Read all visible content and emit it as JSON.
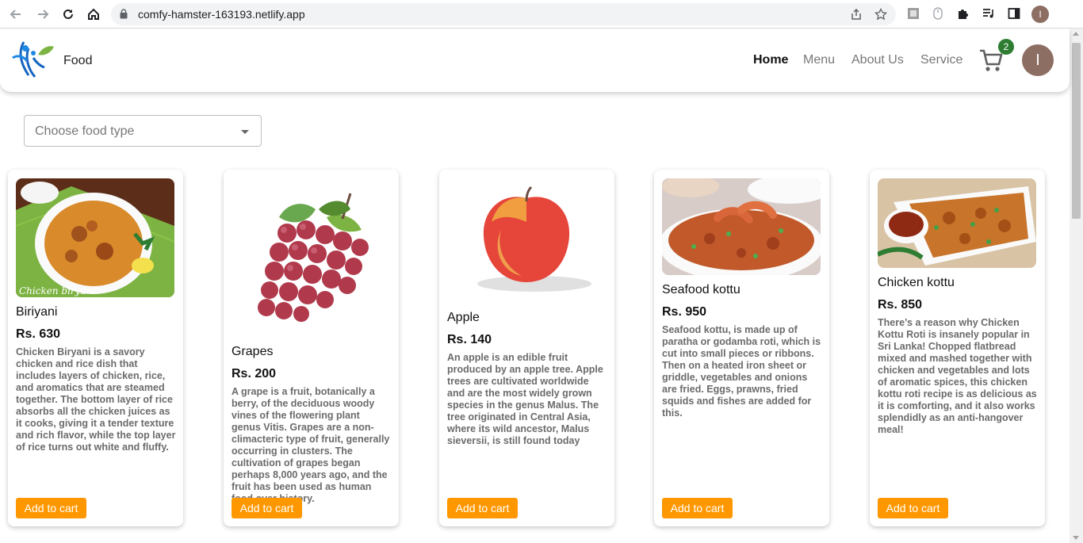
{
  "browser": {
    "url": "comfy-hamster-163193.netlify.app",
    "profile_initial": "I"
  },
  "header": {
    "brand": "Food",
    "nav": [
      {
        "label": "Home",
        "active": true
      },
      {
        "label": "Menu",
        "active": false
      },
      {
        "label": "About Us",
        "active": false
      },
      {
        "label": "Service",
        "active": false
      }
    ],
    "cart_count": "2",
    "avatar_initial": "I"
  },
  "filter": {
    "placeholder": "Choose food type"
  },
  "products": [
    {
      "name": "Biriyani",
      "price": "Rs. 630",
      "description": "Chicken Biryani is a savory chicken and rice dish that includes layers of chicken, rice, and aromatics that are steamed together. The bottom layer of rice absorbs all the chicken juices as it cooks, giving it a tender texture and rich flavor, while the top layer of rice turns out white and fluffy.",
      "image_caption": "Chicken biryani",
      "button": "Add to cart"
    },
    {
      "name": "Grapes",
      "price": "Rs. 200",
      "description": "A grape is a fruit, botanically a berry, of the deciduous woody vines of the flowering plant genus Vitis. Grapes are a non-climacteric type of fruit, generally occurring in clusters. The cultivation of grapes began perhaps 8,000 years ago, and the fruit has been used as human food over history.",
      "button": "Add to cart"
    },
    {
      "name": "Apple",
      "price": "Rs. 140",
      "description": "An apple is an edible fruit produced by an apple tree. Apple trees are cultivated worldwide and are the most widely grown species in the genus Malus. The tree originated in Central Asia, where its wild ancestor, Malus sieversii, is still found today",
      "button": "Add to cart"
    },
    {
      "name": "Seafood kottu",
      "price": "Rs. 950",
      "description": "Seafood kottu, is made up of paratha or godamba roti, which is cut into small pieces or ribbons. Then on a heated iron sheet or griddle, vegetables and onions are fried. Eggs, prawns, fried squids and fishes are added for this.",
      "button": "Add to cart"
    },
    {
      "name": "Chicken kottu",
      "price": "Rs. 850",
      "description": "There’s a reason why Chicken Kottu Roti is insanely popular in Sri Lanka! Chopped flatbread mixed and mashed together with chicken and vegetables and lots of aromatic spices, this chicken kottu roti recipe is as delicious as it is comforting, and it also works splendidly as an anti-hangover meal!",
      "button": "Add to cart"
    }
  ],
  "colors": {
    "accent": "#ff9800",
    "badge": "#2e7d32",
    "avatar": "#8d6e63"
  }
}
